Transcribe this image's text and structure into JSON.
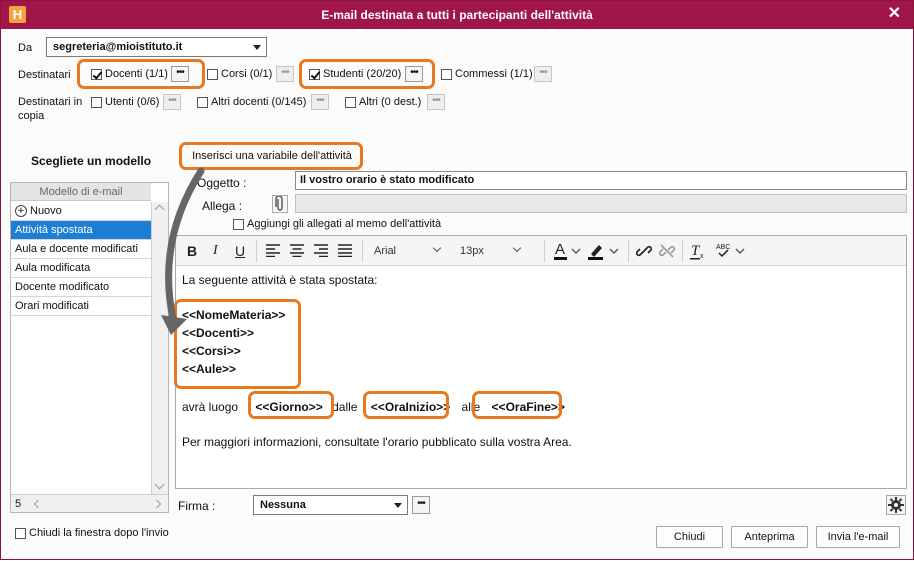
{
  "window": {
    "title": "E-mail destinata a tutti i partecipanti dell'attività",
    "app_icon_letter": "H",
    "close_glyph": "✕"
  },
  "from": {
    "label": "Da",
    "value": "segreteria@mioistituto.it"
  },
  "recipients": {
    "label": "Destinatari",
    "items": [
      {
        "label": "Docenti (1/1)",
        "checked": true
      },
      {
        "label": "Corsi (0/1)",
        "checked": false
      },
      {
        "label": "Studenti (20/20)",
        "checked": true
      },
      {
        "label": "Commessi (1/1)",
        "checked": false
      }
    ]
  },
  "cc": {
    "label_line1": "Destinatari in",
    "label_line2": "copia",
    "items": [
      {
        "label": "Utenti (0/6)",
        "checked": false
      },
      {
        "label": "Altri docenti (0/145)",
        "checked": false
      },
      {
        "label": "Altri (0 dest.)",
        "checked": false
      }
    ]
  },
  "dots_glyph": "•••",
  "templates": {
    "heading": "Scegliete un modello",
    "column_header": "Modello di e-mail",
    "items": [
      {
        "label": "Nuovo",
        "icon": "plus-circle-icon"
      },
      {
        "label": "Attività spostata",
        "selected": true
      },
      {
        "label": "Aula e docente modificati"
      },
      {
        "label": "Aula modificata"
      },
      {
        "label": "Docente modificato"
      },
      {
        "label": "Orari modificati"
      }
    ],
    "count": "5",
    "trash_icon": "trash-icon"
  },
  "insert_variable_button": "Inserisci una variabile dell'attività",
  "subject": {
    "label": "Oggetto :",
    "value": "Il vostro orario è stato modificato"
  },
  "attach": {
    "label": "Allega :",
    "include_memo_label": "Aggiungi gli allegati al memo dell'attività"
  },
  "editor": {
    "toolbar": {
      "bold": "B",
      "italic": "I",
      "underline": "U",
      "font": "Arial",
      "size": "13px"
    },
    "body": {
      "line1": "La seguente attività è stata spostata:",
      "var_subject": "<<NomeMateria>>",
      "var_teachers": "<<Docenti>>",
      "var_courses": "<<Corsi>>",
      "var_rooms": "<<Aule>>",
      "text_will_take_place": "avrà luogo",
      "var_day": "<<Giorno>>",
      "text_from": "dalle",
      "var_start": "<<OraInizio>>",
      "text_to": "alle",
      "var_end": "<<OraFine>>",
      "line_info": "Per maggiori informazioni, consultate l'orario pubblicato sulla vostra Area."
    }
  },
  "signature": {
    "label": "Firma :",
    "value": "Nessuna"
  },
  "close_after_send_label": "Chiudi la finestra dopo l'invio",
  "buttons": {
    "close": "Chiudi",
    "preview": "Anteprima",
    "send": "Invia l'e-mail"
  },
  "colors": {
    "titlebar": "#a0164a",
    "highlight": "#e8791f",
    "selection": "#1c7fd6"
  }
}
